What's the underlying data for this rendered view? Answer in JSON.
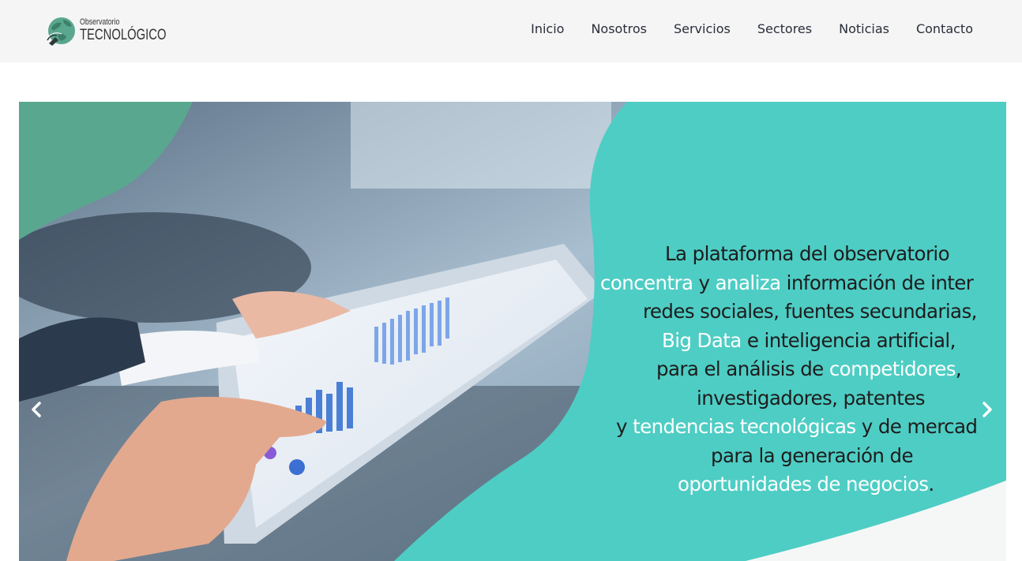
{
  "header": {
    "logo": {
      "line1": "Observatorio",
      "line2": "TECNOLÓGICO"
    },
    "nav": [
      "Inicio",
      "Nosotros",
      "Servicios",
      "Sectores",
      "Noticias",
      "Contacto"
    ]
  },
  "hero": {
    "lines": [
      [
        {
          "t": "La plataforma del observatorio",
          "h": false
        }
      ],
      [
        {
          "t": "concentra",
          "h": true
        },
        {
          "t": " y ",
          "h": false
        },
        {
          "t": "analiza",
          "h": true
        },
        {
          "t": " información de inter",
          "h": false
        }
      ],
      [
        {
          "t": "redes sociales, fuentes secundarias,",
          "h": false
        }
      ],
      [
        {
          "t": "Big Data",
          "h": true
        },
        {
          "t": " e inteligencia artificial,",
          "h": false
        }
      ],
      [
        {
          "t": "para el análisis de ",
          "h": false
        },
        {
          "t": "competidores",
          "h": true
        },
        {
          "t": ",",
          "h": false
        }
      ],
      [
        {
          "t": "investigadores, patentes",
          "h": false
        }
      ],
      [
        {
          "t": "y ",
          "h": false
        },
        {
          "t": "tendencias tecnológicas",
          "h": true
        },
        {
          "t": " y de mercad",
          "h": false
        }
      ],
      [
        {
          "t": "para la generación de",
          "h": false
        }
      ],
      [
        {
          "t": "oportunidades de negocios",
          "h": true
        },
        {
          "t": ".",
          "h": false
        }
      ]
    ],
    "line_indents": [
      82,
      0,
      54,
      78,
      71,
      122,
      20,
      140,
      98
    ]
  },
  "colors": {
    "teal": "#4ecdc4",
    "dark_green": "#5aa78f",
    "nav_text": "#2a2d3a",
    "highlight": "#fdfefd"
  },
  "icons": {
    "prev": "chevron-left-icon",
    "next": "chevron-right-icon"
  }
}
